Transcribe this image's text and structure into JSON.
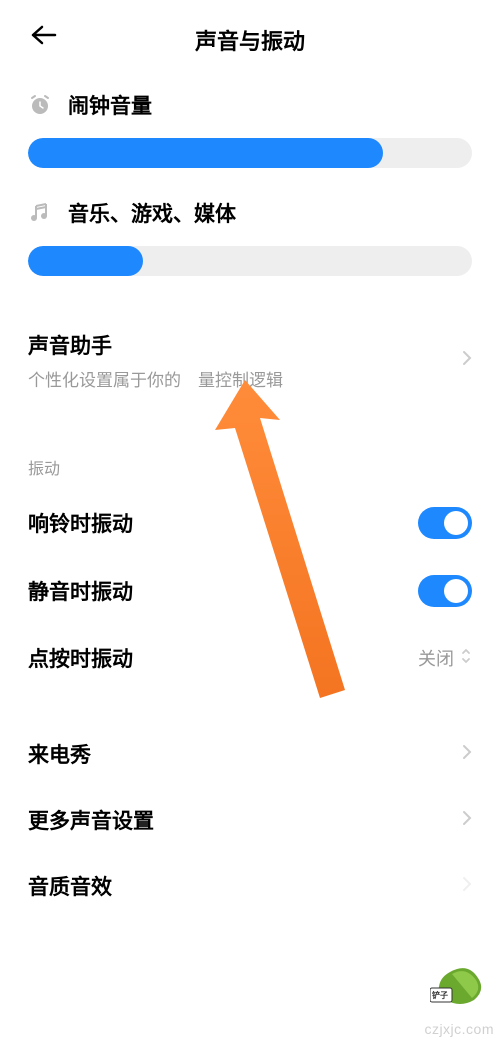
{
  "header": {
    "title": "声音与振动"
  },
  "sliders": {
    "alarm": {
      "label": "闹钟音量",
      "percent": 80
    },
    "media": {
      "label": "音乐、游戏、媒体",
      "percent": 26
    }
  },
  "assistant": {
    "title": "声音助手",
    "subtitle_prefix": "个性化设置属于你的",
    "subtitle_suffix": "量控制逻辑"
  },
  "vibration": {
    "section": "振动",
    "ring": {
      "label": "响铃时振动",
      "enabled": true
    },
    "silent": {
      "label": "静音时振动",
      "enabled": true
    },
    "tap": {
      "label": "点按时振动",
      "value": "关闭"
    }
  },
  "more": {
    "callshow": "来电秀",
    "more_sound": "更多声音设置",
    "sound_quality": "音质音效"
  },
  "watermark": "czjxjc.com",
  "colors": {
    "accent": "#1e88ff",
    "arrow": "#f47421"
  }
}
